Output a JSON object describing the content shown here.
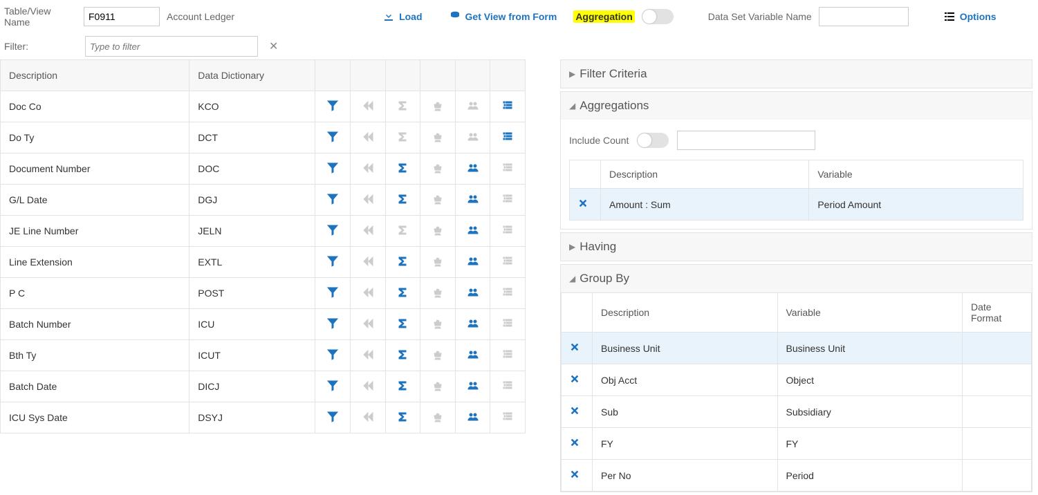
{
  "top": {
    "tableViewLabel": "Table/View Name",
    "tableViewValue": "F0911",
    "tableViewDesc": "Account Ledger",
    "loadLabel": "Load",
    "getViewLabel": "Get View from Form",
    "aggregationLabel": "Aggregation",
    "dataSetVarLabel": "Data Set Variable Name",
    "dataSetVarValue": "",
    "optionsLabel": "Options"
  },
  "filter": {
    "label": "Filter:",
    "placeholder": "Type to filter"
  },
  "gridHeaders": {
    "description": "Description",
    "dataDictionary": "Data Dictionary"
  },
  "gridRows": [
    {
      "desc": "Doc Co",
      "dd": "KCO",
      "sigma": false,
      "group": false,
      "list": true
    },
    {
      "desc": "Do Ty",
      "dd": "DCT",
      "sigma": false,
      "group": false,
      "list": true
    },
    {
      "desc": "Document Number",
      "dd": "DOC",
      "sigma": true,
      "group": true,
      "list": false
    },
    {
      "desc": "G/L Date",
      "dd": "DGJ",
      "sigma": true,
      "group": true,
      "list": false
    },
    {
      "desc": "JE Line Number",
      "dd": "JELN",
      "sigma": false,
      "group": true,
      "list": false
    },
    {
      "desc": "Line Extension",
      "dd": "EXTL",
      "sigma": true,
      "group": true,
      "list": false
    },
    {
      "desc": "P C",
      "dd": "POST",
      "sigma": true,
      "group": true,
      "list": false
    },
    {
      "desc": "Batch Number",
      "dd": "ICU",
      "sigma": true,
      "group": true,
      "list": false
    },
    {
      "desc": "Bth Ty",
      "dd": "ICUT",
      "sigma": true,
      "group": true,
      "list": false
    },
    {
      "desc": "Batch Date",
      "dd": "DICJ",
      "sigma": true,
      "group": true,
      "list": false
    },
    {
      "desc": "ICU Sys Date",
      "dd": "DSYJ",
      "sigma": true,
      "group": true,
      "list": false
    }
  ],
  "panels": {
    "filterCriteria": "Filter Criteria",
    "aggregations": "Aggregations",
    "having": "Having",
    "groupBy": "Group By"
  },
  "agg": {
    "includeCountLabel": "Include Count",
    "headers": {
      "description": "Description",
      "variable": "Variable"
    },
    "rows": [
      {
        "desc": "Amount : Sum",
        "var": "Period Amount",
        "selected": true
      }
    ]
  },
  "group": {
    "headers": {
      "description": "Description",
      "variable": "Variable",
      "dateFormat": "Date Format"
    },
    "rows": [
      {
        "desc": "Business Unit",
        "var": "Business Unit",
        "df": "",
        "selected": true
      },
      {
        "desc": "Obj Acct",
        "var": "Object",
        "df": ""
      },
      {
        "desc": "Sub",
        "var": "Subsidiary",
        "df": ""
      },
      {
        "desc": "FY",
        "var": "FY",
        "df": ""
      },
      {
        "desc": "Per No",
        "var": "Period",
        "df": ""
      }
    ]
  }
}
